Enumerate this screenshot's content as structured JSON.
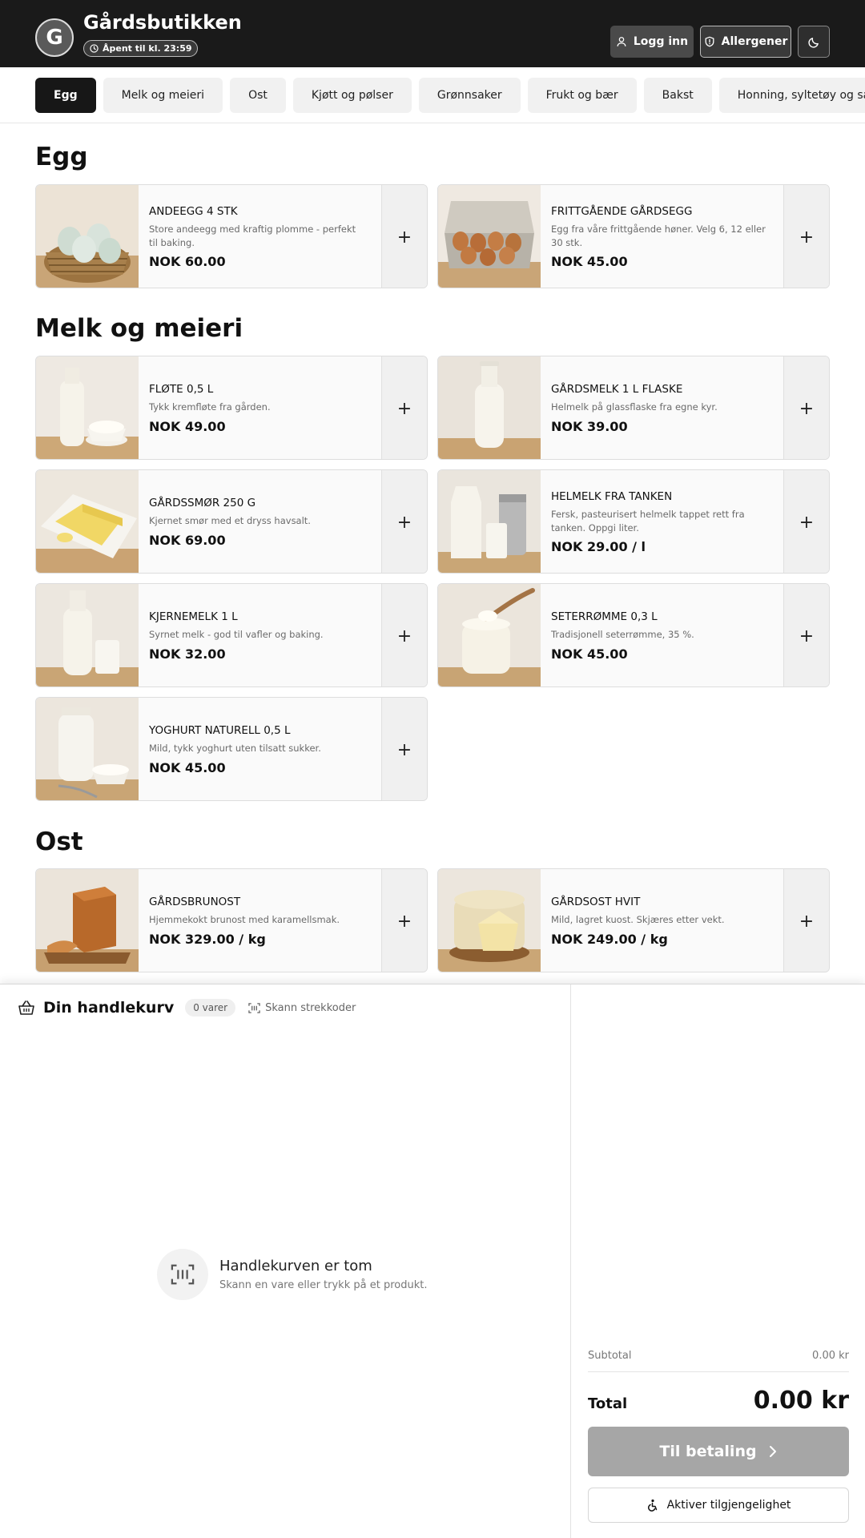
{
  "header": {
    "logo_letter": "G",
    "store_name": "Gårdsbutikken",
    "open_status": "Åpent til kl. 23:59",
    "login_label": "Logg inn",
    "allergen_label": "Allergener",
    "icons": {
      "login": "user-icon",
      "allergen": "shield-icon",
      "theme": "moon-icon",
      "status": "clock-icon"
    }
  },
  "tabs": [
    "Egg",
    "Melk og meieri",
    "Ost",
    "Kjøtt og pølser",
    "Grønnsaker",
    "Frukt og bær",
    "Bakst",
    "Honning, syltetøy og saft"
  ],
  "active_tab": "Egg",
  "sections": {
    "egg": {
      "title": "Egg",
      "products": [
        {
          "name": "ANDEEGG 4 STK",
          "desc": "Store andeegg med kraftig plomme - perfekt til baking.",
          "price": "NOK 60.00"
        },
        {
          "name": "FRITTGÅENDE GÅRDSEGG",
          "desc": "Egg fra våre frittgående høner. Velg 6, 12 eller 30 stk.",
          "price": "NOK 45.00"
        }
      ]
    },
    "dairy": {
      "title": "Melk og meieri",
      "products": [
        {
          "name": "FLØTE 0,5 L",
          "desc": "Tykk kremfløte fra gården.",
          "price": "NOK 49.00"
        },
        {
          "name": "GÅRDSMELK 1 L FLASKE",
          "desc": "Helmelk på glassflaske fra egne kyr.",
          "price": "NOK 39.00"
        },
        {
          "name": "GÅRDSSMØR 250 G",
          "desc": "Kjernet smør med et dryss havsalt.",
          "price": "NOK 69.00"
        },
        {
          "name": "HELMELK FRA TANKEN",
          "desc": "Fersk, pasteurisert helmelk tappet rett fra tanken. Oppgi liter.",
          "price": "NOK 29.00 / l"
        },
        {
          "name": "KJERNEMELK 1 L",
          "desc": "Syrnet melk - god til vafler og baking.",
          "price": "NOK 32.00"
        },
        {
          "name": "SETERRØMME 0,3 L",
          "desc": "Tradisjonell seterrømme, 35 %.",
          "price": "NOK 45.00"
        },
        {
          "name": "YOGHURT NATURELL 0,5 L",
          "desc": "Mild, tykk yoghurt uten tilsatt sukker.",
          "price": "NOK 45.00"
        }
      ]
    },
    "cheese": {
      "title": "Ost",
      "products": [
        {
          "name": "GÅRDSBRUNOST",
          "desc": "Hjemmekokt brunost med karamellsmak.",
          "price": "NOK 329.00 / kg"
        },
        {
          "name": "GÅRDSOST HVIT",
          "desc": "Mild, lagret kuost. Skjæres etter vekt.",
          "price": "NOK 249.00 / kg"
        }
      ]
    }
  },
  "add_symbol": "+",
  "cart": {
    "title": "Din handlekurv",
    "count": "0 varer",
    "scan_label": "Skann strekkoder",
    "empty_title": "Handlekurven er tom",
    "empty_sub": "Skann en vare eller trykk på et produkt.",
    "subtotal_label": "Subtotal",
    "subtotal_value": "0.00 kr",
    "total_label": "Total",
    "total_value": "0.00 kr",
    "pay_label": "Til betaling",
    "a11y_label": "Aktiver tilgjengelighet"
  },
  "colors": {
    "header_bg": "#1a1a1a",
    "active_tab": "#171717",
    "pay_disabled": "#a6a6a6"
  }
}
